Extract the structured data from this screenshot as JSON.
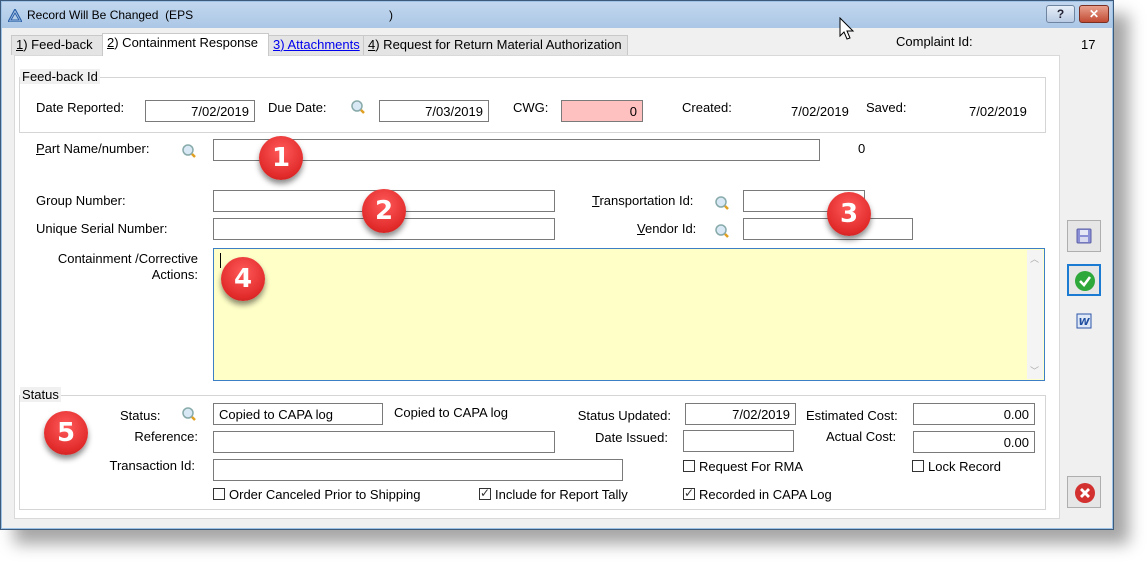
{
  "window": {
    "title": "Record Will Be Changed  (EPS",
    "title_suffix": ")",
    "help_label": "?",
    "close_label": "✕"
  },
  "tabs": [
    {
      "num": "1",
      "label": ") Feed-back",
      "active": false
    },
    {
      "num": "2",
      "label": ") Containment Response",
      "active": true
    },
    {
      "num": "3",
      "label": ") Attachments",
      "active": false
    },
    {
      "num": "4",
      "label": ") Request for Return Material Authorization",
      "active": false
    }
  ],
  "complaint": {
    "label": "Complaint Id:",
    "value": "17"
  },
  "feedback_group": {
    "legend": "Feed-back Id",
    "date_reported_label": "Date Reported:",
    "date_reported": "7/02/2019",
    "due_date_label": "Due Date:",
    "due_date": "7/03/2019",
    "cwg_label": "CWG:",
    "cwg": "0",
    "created_label": "Created:",
    "created": "7/02/2019",
    "saved_label": "Saved:",
    "saved": "7/02/2019"
  },
  "part": {
    "label_underline": "P",
    "label": "art Name/number:",
    "value": "",
    "count": "0"
  },
  "group_number": {
    "label": "Group Number:",
    "value": ""
  },
  "serial": {
    "label": "Unique Serial Number:",
    "value": ""
  },
  "transport": {
    "label_underline": "T",
    "label": "ransportation Id:",
    "value": ""
  },
  "vendor": {
    "label_underline": "V",
    "label": "endor Id:",
    "value": ""
  },
  "containment": {
    "label_line1": "Containment /Corrective",
    "label_line2": "Actions:",
    "value": ""
  },
  "status_group": {
    "legend": "Status",
    "status_label": "Status:",
    "status_value": "Copied to CAPA log",
    "status_desc": "Copied to CAPA log",
    "reference_label": "Reference:",
    "reference": "",
    "transaction_label": "Transaction Id:",
    "transaction": "",
    "status_updated_label": "Status Updated:",
    "status_updated": "7/02/2019",
    "date_issued_label": "Date Issued:",
    "date_issued": "",
    "est_cost_label": "Estimated Cost:",
    "est_cost": "0.00",
    "actual_cost_label": "Actual Cost:",
    "actual_cost": "0.00",
    "checkboxes": {
      "order_canceled": {
        "label": "Order Canceled Prior to Shipping",
        "checked": false
      },
      "include_tally": {
        "label": "Include for Report Tally",
        "checked": true
      },
      "request_rma": {
        "label": "Request For RMA",
        "checked": false
      },
      "recorded_capa": {
        "label": "Recorded in CAPA Log",
        "checked": true
      },
      "lock_record": {
        "label": "Lock Record",
        "checked": false
      }
    }
  },
  "badges": [
    "1",
    "2",
    "3",
    "4",
    "5"
  ],
  "side_buttons": [
    "save-icon",
    "ok-check-icon",
    "word-export-icon",
    "cancel-icon"
  ]
}
